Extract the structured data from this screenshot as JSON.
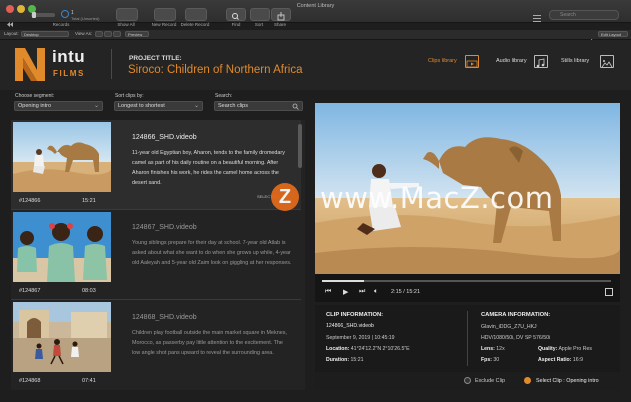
{
  "window": {
    "title": "Content Library",
    "search_placeholder": "Search"
  },
  "toolbar": {
    "records_label": "Records",
    "count": "1",
    "count_caption": "Total (Unsorted)",
    "show_all": "Show All",
    "new_record": "New Record",
    "delete_record": "Delete Record",
    "find": "Find",
    "sort": "Sort",
    "share": "Share"
  },
  "layout_bar": {
    "layout_label": "Layout:",
    "layout_value": "Desktop",
    "view_as": "View As:",
    "preview": "Preview",
    "edit_layout": "Edit Layout"
  },
  "header": {
    "logo_main": "intu",
    "logo_sub": "FILMS",
    "project_label": "PROJECT TITLE:",
    "project_title": "Siroco: Children of Northern Africa",
    "libraries": [
      {
        "label": "Clips library",
        "active": true
      },
      {
        "label": "Audio library",
        "active": false
      },
      {
        "label": "Stills library",
        "active": false
      }
    ]
  },
  "controls": {
    "segment_label": "Choose segment:",
    "segment_value": "Opening intro",
    "sort_label": "Sort clips by:",
    "sort_value": "Longest to shortest",
    "search_label": "Search:",
    "search_placeholder": "Search clips"
  },
  "clips": [
    {
      "title": "124866_SHD.videob",
      "description": "11-year old Egyptian boy, Aharon, tends to the family dromedary camel as part of his daily routine on a beautiful morning. After Aharon finishes his work, he rides the camel home across the desert sand.",
      "id": "#124866",
      "duration": "15:21",
      "selected_label": "SELECTED"
    },
    {
      "title": "124867_SHD.videob",
      "description": "Young siblings prepare for their day at school. 7-year old Atlab is asked about what she want to do when she grows up while, 4-year old Aaleyah and 5-year old Zaim look on giggling at her responses.",
      "id": "#124867",
      "duration": "08:03"
    },
    {
      "title": "124868_SHD.videob",
      "description": "Children play football outside the main market square in Meknes, Morocco, as passerby pay little attention to the excitement.  The low angle shot pans upward to reveal the surrounding area.",
      "id": "#124868",
      "duration": "07:41"
    }
  ],
  "player": {
    "timecode": "2:15 / 15:21",
    "progress": 0.147
  },
  "clip_info": {
    "heading": "CLIP INFORMATION:",
    "filename": "124866_SHD.videob",
    "datetime": "September 9, 2019  |  10:45:19",
    "location_label": "Location:",
    "location": "41°24'12.2\"N  2°10'26.5\"E",
    "duration_label": "Duration:",
    "duration": "15:21"
  },
  "camera_info": {
    "heading": "CAMERA INFORMATION:",
    "model": "Glavin_iDDG_Z7U_HKJ",
    "format": "HDV/1080/50i, DV SP 576/50i",
    "lens_label": "Lens:",
    "lens": "12x",
    "fps_label": "Fps:",
    "fps": "30",
    "quality_label": "Quality:",
    "quality": "Apple Pro Res",
    "aspect_label": "Aspect Ratio:",
    "aspect": "16:9"
  },
  "bottom": {
    "exclude": "Exclude Clip",
    "select": "Select Clip : Opening intro"
  },
  "watermark": {
    "badge": "Z",
    "text": "www.MacZ.com"
  },
  "colors": {
    "accent": "#e08a2c",
    "background": "#1e1e1e"
  }
}
